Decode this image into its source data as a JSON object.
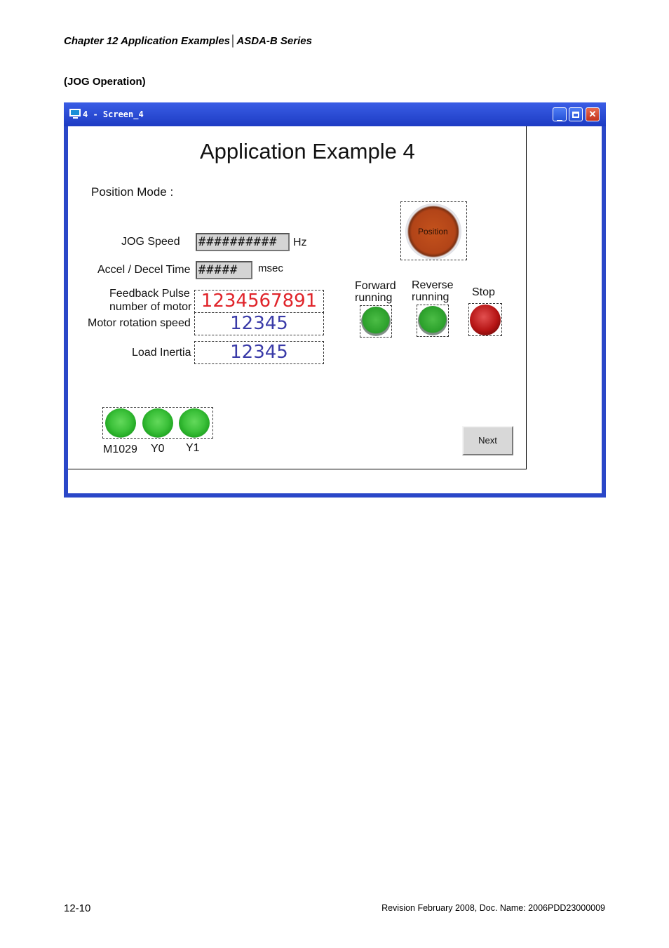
{
  "header": "Chapter 12  Application Examples│ASDA-B Series",
  "section_title": "(JOG Operation)",
  "window": {
    "title": "4 - Screen_4",
    "app_title": "Application Example 4",
    "mode_label": "Position Mode :",
    "jog_speed": {
      "label": "JOG Speed",
      "value": "##########",
      "unit": "Hz"
    },
    "accel": {
      "label": "Accel / Decel Time",
      "value": "#####",
      "unit": "msec"
    },
    "feedback": {
      "label1": "Feedback Pulse",
      "label2": "number of motor",
      "value": "1234567891"
    },
    "rotation": {
      "label": "Motor rotation speed",
      "value": "12345"
    },
    "inertia": {
      "label": "Load Inertia",
      "value": "12345"
    },
    "position_button": "Position",
    "forward": {
      "label1": "Forward",
      "label2": "running"
    },
    "reverse": {
      "label1": "Reverse",
      "label2": "running"
    },
    "stop": "Stop",
    "lamps": [
      "M1029",
      "Y0",
      "Y1"
    ],
    "next_button": "Next"
  },
  "colors": {
    "titlebar": "#2a47c8",
    "red_number": "#e0242a",
    "blue_number": "#3a3ba8"
  },
  "footer": {
    "page": "12-10",
    "revision": "Revision February 2008, Doc. Name: 2006PDD23000009"
  }
}
